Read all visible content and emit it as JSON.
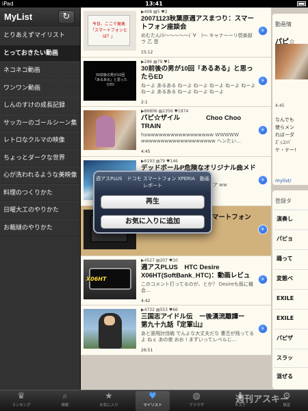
{
  "status": {
    "device": "iPad",
    "time": "13:41"
  },
  "sidebar": {
    "title": "MyList",
    "refresh_icon": "refresh-icon",
    "items": [
      {
        "label": "とりあえずマイリスト",
        "selected": false
      },
      {
        "label": "とっておきたい動画",
        "selected": true
      },
      {
        "label": "ネコネコ動画",
        "selected": false
      },
      {
        "label": "ワンワン動画",
        "selected": false
      },
      {
        "label": "しんのすけの成長記録",
        "selected": false
      },
      {
        "label": "サッカーのゴールシーン集",
        "selected": false
      },
      {
        "label": "レトロなクルマの映像",
        "selected": false
      },
      {
        "label": "ちょっとダークな世界",
        "selected": false
      },
      {
        "label": "心が洗われるような美映像",
        "selected": false
      },
      {
        "label": "料理のつくりかた",
        "selected": false
      },
      {
        "label": "日曜大工のやりかた",
        "selected": false
      },
      {
        "label": "お裁縫のやりかた",
        "selected": false
      }
    ]
  },
  "videos": [
    {
      "views": "408",
      "comments": "5",
      "mylist": "2",
      "title": "20071123秋葉原週アスまつり：スマートフォン座談会",
      "desc": "めむたんi!i〜〜〜〜〜(´∀｀)〜 キャナーーリ倶楽部ラ 乙 音",
      "duration": "15:12",
      "thumb_text": "今日、ここで発表「スマートフォンとは？」"
    },
    {
      "views": "296",
      "comments": "79",
      "mylist": "1",
      "title": "30前後の男が10回「あるある」と思ったらED",
      "desc": "ねーよ あるある ねーよ ねーよ ねーよ ねーよ ねーよ ねーよ あるある ねーよ ねーよ ねーよ",
      "duration": "2:1",
      "thumb_text": "30前後の男が10回「あるある」と思ったらED"
    },
    {
      "views": "86806",
      "comments": "2356",
      "mylist": "1974",
      "title": "パピ☆ザイル　　　　Choo Choo TRAIN",
      "desc": "hawwwwwwwwwwwwwwwww WWWWW wwwwwwwwwwwwwwwwwww ヘンたい…",
      "duration": "4:45",
      "thumb_text": ""
    },
    {
      "views": "6193",
      "comments": "79",
      "mylist": "146",
      "title": "デッドボールP危険なオリジナル曲メドレー",
      "desc": "アアアアアアアアアアアアアアアア ww",
      "duration": "",
      "thumb_text": ""
    },
    {
      "views": "",
      "comments": "",
      "mylist": "",
      "title": "週アスPLUS　ドコモ スマートフォン XPERIA　動画レポート",
      "desc": "",
      "duration": "",
      "thumb_text": ""
    },
    {
      "views": "4527",
      "comments": "207",
      "mylist": "10",
      "title": "週アスPLUS　HTC Desire X06HT(SoftBank_HTC)：動画レビュー",
      "desc": "このコメント打ってるのが、とか？ Desireも既に機会…",
      "duration": "4:42",
      "thumb_text": "X06HT"
    },
    {
      "views": "4732",
      "comments": "553",
      "mylist": "66",
      "title": "三国志アイドル伝　ー後漢流離譚ー　第九十九話『定軍山』",
      "desc": "あと張飛討伐戦 でんよな大丈夫だな 曹丕が残ってるよ ねぇ あの夜 おお ! まずいってレベルじ…",
      "duration": "26:51",
      "thumb_text": ""
    }
  ],
  "popup": {
    "title": "週アスPLUS　ドコモ スマートフォン XPERIA　動画レポート",
    "play_label": "再生",
    "favorite_label": "お気に入りに追加"
  },
  "right_panel": {
    "header": "動画情",
    "video_title": "パピ☆",
    "duration": "4:45",
    "desc": "なんでも\n使らメン\nればーダ\nｽﾞｯｺﾝﾊﾞ\nケ・テー!",
    "link": "mylist/",
    "tags_header": "登録タ",
    "tags": [
      "演奏し",
      "パピョ",
      "踊って",
      "変態ベ",
      "EXILE",
      "EXILE",
      "パピザ",
      "スラッ",
      "混ぜる"
    ]
  },
  "tabbar": {
    "tabs": [
      {
        "label": "ランキング",
        "icon": "crown-icon",
        "glyph": "♛",
        "active": false
      },
      {
        "label": "検索",
        "icon": "search-icon",
        "glyph": "⌕",
        "active": false
      },
      {
        "label": "お気に入り",
        "icon": "star-icon",
        "glyph": "★",
        "active": false
      },
      {
        "label": "マイリスト",
        "icon": "heart-icon",
        "glyph": "♥",
        "active": true
      },
      {
        "label": "ブラウザ",
        "icon": "globe-icon",
        "glyph": "◍",
        "active": false
      },
      {
        "label": "タスク",
        "icon": "download-icon",
        "glyph": "⬇",
        "active": false
      },
      {
        "label": "設定",
        "icon": "gear-icon",
        "glyph": "⚙",
        "active": false
      }
    ]
  },
  "watermark": "週刊アスキー",
  "colors": {
    "sidebar_bg": "#333333",
    "row_bg": "#fdfaf0",
    "row_highlight": "#d2b27c",
    "popup_bg": "#26324a",
    "accent": "#2f6fd8"
  }
}
